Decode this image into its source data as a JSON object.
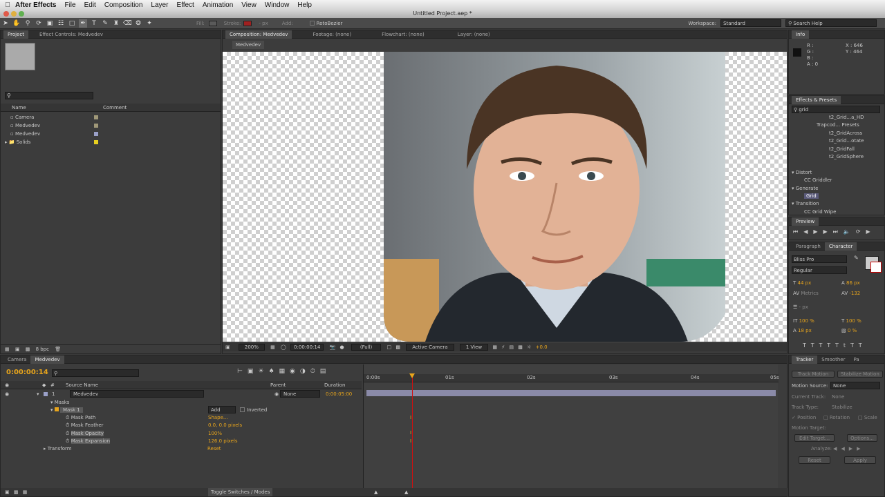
{
  "menubar": {
    "app_name": "After Effects",
    "items": [
      "File",
      "Edit",
      "Composition",
      "Layer",
      "Effect",
      "Animation",
      "View",
      "Window",
      "Help"
    ]
  },
  "window": {
    "title": "Untitled Project.aep *"
  },
  "toolbar": {
    "fill_label": "Fill:",
    "stroke_label": "Stroke:",
    "stroke_width": "- px",
    "add_label": "Add:",
    "rotobezier_label": "RotoBezier",
    "workspace_label": "Workspace:",
    "workspace_value": "Standard",
    "search_placeholder": "Search Help"
  },
  "project_panel": {
    "tab_project": "Project",
    "tab_effect_controls": "Effect Controls: Medvedev",
    "search_placeholder": "",
    "col_name": "Name",
    "col_comment": "Comment",
    "items": [
      {
        "name": "Camera",
        "color": "#a09878"
      },
      {
        "name": "Medvedev",
        "color": "#a09878"
      },
      {
        "name": "Medvedev",
        "color": "#9aa0c8"
      },
      {
        "name": "Solids",
        "color": "#e8d020"
      }
    ],
    "bpc": "8 bpc"
  },
  "comp_panel": {
    "tab_composition": "Composition: Medvedev",
    "tab_footage": "Footage: (none)",
    "tab_flowchart": "Flowchart: (none)",
    "tab_layer": "Layer: (none)",
    "comp_name_tab": "Medvedev",
    "zoom": "200%",
    "timecode": "0:00:00:14",
    "resolution": "(Full)",
    "camera": "Active Camera",
    "view": "1 View",
    "exposure": "+0.0"
  },
  "info_panel": {
    "title": "Info",
    "r": "R :",
    "g": "G :",
    "b": "B :",
    "a": "A : 0",
    "x": "X : 646",
    "y": "Y : 464"
  },
  "effects_panel": {
    "title": "Effects & Presets",
    "search_value": "grid",
    "items": [
      {
        "label": "t2_Grid...a_HD",
        "indent": 3
      },
      {
        "label": "Trapcod... Presets",
        "indent": 2
      },
      {
        "label": "t2_GridAcross",
        "indent": 3
      },
      {
        "label": "t2_Grid...otate",
        "indent": 3
      },
      {
        "label": "t2_GridFall",
        "indent": 3
      },
      {
        "label": "t2_GridSphere",
        "indent": 3
      },
      {
        "label": "",
        "indent": 0
      },
      {
        "label": "Distort",
        "indent": 0
      },
      {
        "label": "CC Griddler",
        "indent": 1
      },
      {
        "label": "Generate",
        "indent": 0
      },
      {
        "label": "Grid",
        "indent": 1,
        "selected": true
      },
      {
        "label": "Transition",
        "indent": 0
      },
      {
        "label": "CC Grid Wipe",
        "indent": 1
      }
    ]
  },
  "preview_panel": {
    "title": "Preview"
  },
  "character_panel": {
    "tab_paragraph": "Paragraph",
    "tab_character": "Character",
    "font": "Bliss Pro",
    "style": "Regular",
    "size": "44 px",
    "leading": "86 px",
    "kerning": "Metrics",
    "tracking": "-132",
    "stroke": "- px",
    "vscale": "100 %",
    "hscale": "100 %",
    "baseline": "18 px",
    "tsume": "0 %"
  },
  "timeline": {
    "tab_camera": "Camera",
    "tab_medvedev": "Medvedev",
    "timecode": "0:00:00:14",
    "search_placeholder": "",
    "col_source_name": "Source Name",
    "col_parent": "Parent",
    "col_duration": "Duration",
    "layer_number": "1",
    "layer_name": "Medvedev",
    "parent_value": "None",
    "duration": "0:00:05:00",
    "masks_label": "Masks",
    "mask1": "Mask 1",
    "mask_mode": "Add",
    "inverted": "Inverted",
    "props": [
      {
        "name": "Mask Path",
        "value": "Shape..."
      },
      {
        "name": "Mask Feather",
        "value": "0.0, 0.0 pixels"
      },
      {
        "name": "Mask Opacity",
        "value": "100%"
      },
      {
        "name": "Mask Expansion",
        "value": "126.0 pixels"
      }
    ],
    "transform_label": "Transform",
    "transform_value": "Reset",
    "ruler": [
      "0:00s",
      "01s",
      "02s",
      "03s",
      "04s",
      "05s"
    ],
    "toggle_label": "Toggle Switches / Modes"
  },
  "tracker_panel": {
    "tab_tracker": "Tracker",
    "tab_smoother": "Smoother",
    "tab_more": "Pa",
    "track_motion": "Track Motion",
    "stabilize_motion": "Stabilize Motion",
    "motion_source_label": "Motion Source:",
    "motion_source_value": "None",
    "current_track_label": "Current Track:",
    "current_track_value": "None",
    "track_type_label": "Track Type:",
    "track_type_value": "Stabilize",
    "position": "Position",
    "rotation": "Rotation",
    "scale": "Scale",
    "motion_target": "Motion Target:",
    "edit_target": "Edit Target...",
    "options": "Options...",
    "analyze": "Analyze:",
    "reset": "Reset",
    "apply": "Apply"
  }
}
